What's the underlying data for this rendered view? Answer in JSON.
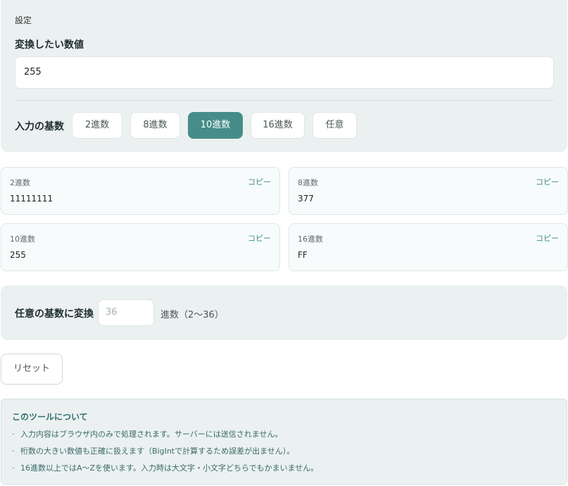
{
  "settings": {
    "title": "設定",
    "value_label": "変換したい数値",
    "value": "255",
    "base_label": "入力の基数",
    "base_options": [
      "2進数",
      "8進数",
      "10進数",
      "16進数",
      "任意"
    ],
    "selected_base": "10進数"
  },
  "results": {
    "copy_label": "コピー",
    "items": [
      {
        "label": "2進数",
        "value": "11111111"
      },
      {
        "label": "8進数",
        "value": "377"
      },
      {
        "label": "10進数",
        "value": "255"
      },
      {
        "label": "16進数",
        "value": "FF"
      }
    ]
  },
  "custom": {
    "label": "任意の基数に変換",
    "placeholder": "36",
    "suffix": "進数（2〜36）"
  },
  "reset_label": "リセット",
  "about": {
    "title": "このツールについて",
    "items": [
      "入力内容はブラウザ内のみで処理されます。サーバーには送信されません。",
      "桁数の大きい数値も正確に扱えます（BigIntで計算するため誤差が出ません）。",
      "16進数以上ではA〜Zを使います。入力時は大文字・小文字どちらでもかまいません。"
    ]
  },
  "colors": {
    "accent": "#468d89",
    "panel_bg": "#ebf1f1",
    "copy_link": "#3d8f89"
  }
}
